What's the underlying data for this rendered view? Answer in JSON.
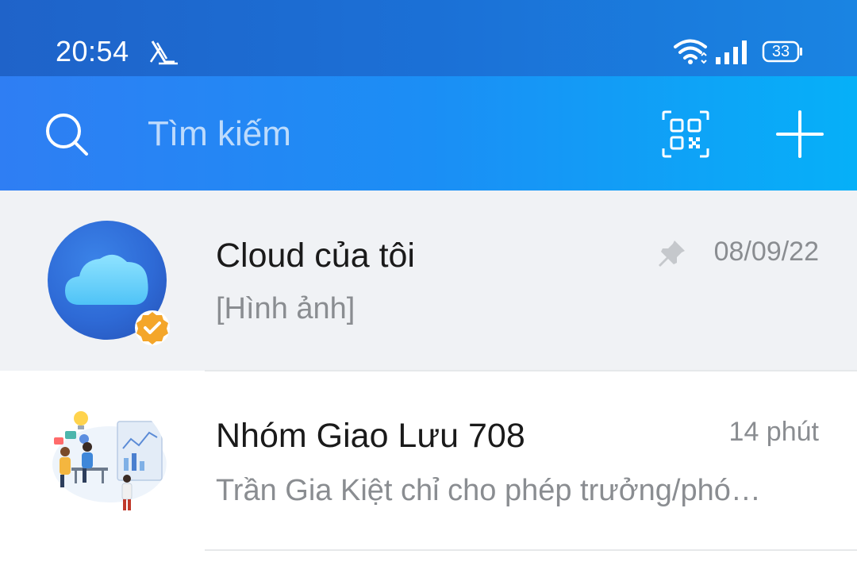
{
  "status_bar": {
    "time": "20:54",
    "battery": "33",
    "app_icon": "reader-app-icon",
    "wifi_icon": "wifi-icon",
    "signal_icon": "cellular-signal-icon"
  },
  "header": {
    "search_placeholder": "Tìm kiếm",
    "search_icon": "search-icon",
    "qr_icon": "qr-code-icon",
    "add_icon": "plus-icon"
  },
  "conversations": [
    {
      "name": "Cloud của tôi",
      "preview": "[Hình ảnh]",
      "time": "08/09/22",
      "pinned": true,
      "avatar": "cloud-avatar",
      "verified": true
    },
    {
      "name": "Nhóm Giao Lưu 708",
      "preview": "Trần Gia Kiệt chỉ cho phép trưởng/phó…",
      "time": "14 phút",
      "pinned": false,
      "avatar": "group-avatar"
    }
  ],
  "colors": {
    "status_bar": "#1b70d6",
    "header_start": "#2f7ef3",
    "header_end": "#06b0f8",
    "pinned_bg": "#f0f2f5",
    "badge": "#f4a62a"
  }
}
